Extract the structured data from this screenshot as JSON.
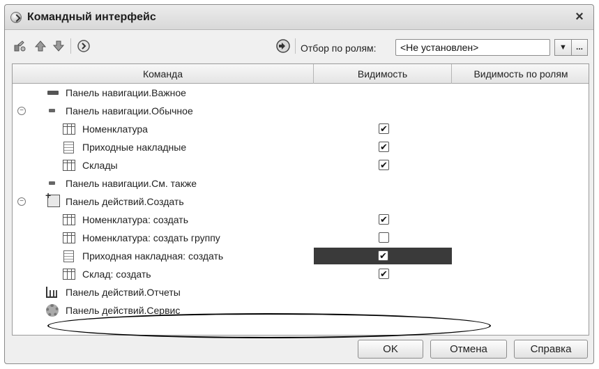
{
  "window": {
    "title": "Командный интерфейс",
    "close_label": "×"
  },
  "toolbar": {
    "icons": [
      "move-icon",
      "arrow-up-icon",
      "arrow-down-icon",
      "go-icon",
      "filter-apply-icon"
    ],
    "filter_label": "Отбор по ролям:",
    "filter_value": "<Не установлен>",
    "dropdown_label": "▼",
    "dots_label": "..."
  },
  "grid": {
    "columns": [
      "Команда",
      "Видимость",
      "Видимость по ролям"
    ],
    "rows": [
      {
        "label": "Панель навигации.Важное",
        "icon": "panel-icon",
        "checked": null
      },
      {
        "label": "Панель навигации.Обычное",
        "icon": "panel-icon",
        "checked": null,
        "expander": "−"
      },
      {
        "label": "Номенклатура",
        "icon": "catalog-icon",
        "checked": "✔"
      },
      {
        "label": "Приходные накладные",
        "icon": "document-icon",
        "checked": "✔"
      },
      {
        "label": "Склады",
        "icon": "catalog-icon",
        "checked": "✔"
      },
      {
        "label": "Панель навигации.См. также",
        "icon": "panel-icon",
        "checked": null
      },
      {
        "label": "Панель действий.Создать",
        "icon": "create-icon",
        "checked": null,
        "expander": "−"
      },
      {
        "label": "Номенклатура: создать",
        "icon": "catalog-icon",
        "checked": "✔"
      },
      {
        "label": "Номенклатура: создать группу",
        "icon": "catalog-icon",
        "checked": ""
      },
      {
        "label": "Приходная накладная: создать",
        "icon": "document-icon",
        "checked": "✔",
        "selected": true
      },
      {
        "label": "Склад: создать",
        "icon": "catalog-icon",
        "checked": "✔"
      },
      {
        "label": "Панель действий.Отчеты",
        "icon": "reports-icon",
        "checked": null
      },
      {
        "label": "Панель действий.Сервис",
        "icon": "gear-icon",
        "checked": null
      }
    ]
  },
  "buttons": {
    "ok": "OK",
    "cancel": "Отмена",
    "help": "Справка"
  }
}
